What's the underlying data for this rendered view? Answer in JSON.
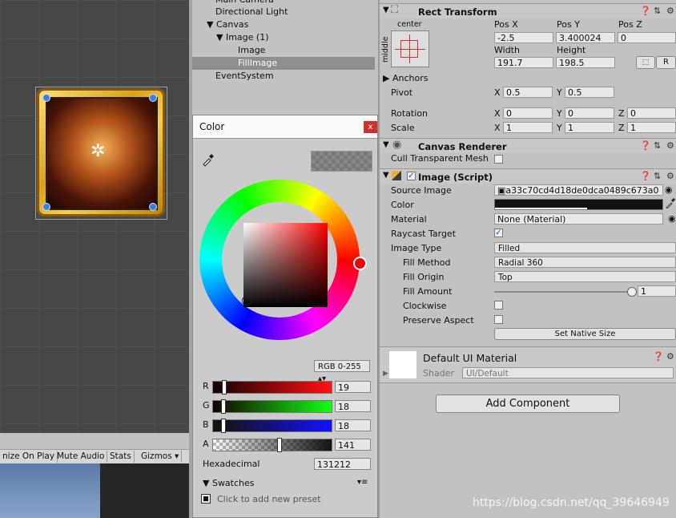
{
  "scene": {
    "pivot_glyph": "✲"
  },
  "game_toolbar": {
    "items": [
      "nize On Play",
      "Mute Audio",
      "Stats",
      "Gizmos ▾"
    ]
  },
  "hierarchy": {
    "items": [
      {
        "label": "Main Camera",
        "indent": 0
      },
      {
        "label": "Directional Light",
        "indent": 0
      },
      {
        "label": "▼ Canvas",
        "indent": 0
      },
      {
        "label": "▼ Image (1)",
        "indent": 1
      },
      {
        "label": "Image",
        "indent": 2
      },
      {
        "label": "FillImage",
        "indent": 2,
        "selected": true
      },
      {
        "label": "EventSystem",
        "indent": 0
      }
    ]
  },
  "color_picker": {
    "title": "Color",
    "close": "x",
    "mode": "RGB 0-255",
    "channels": [
      {
        "label": "R",
        "value": "19",
        "fill": 0.075
      },
      {
        "label": "G",
        "value": "18",
        "fill": 0.07
      },
      {
        "label": "B",
        "value": "18",
        "fill": 0.07
      },
      {
        "label": "A",
        "value": "141",
        "fill": 0.553
      }
    ],
    "hex_label": "Hexadecimal",
    "hex_value": "131212",
    "swatches_label": "▼ Swatches",
    "add_preset": "Click to add new preset"
  },
  "rect_transform": {
    "title": "Rect Transform",
    "anchor_h": "center",
    "anchor_v": "middle",
    "pos_x_label": "Pos X",
    "pos_y_label": "Pos Y",
    "pos_z_label": "Pos Z",
    "pos_x": "-2.5",
    "pos_y": "3.400024",
    "pos_z": "0",
    "width_label": "Width",
    "height_label": "Height",
    "width": "191.7",
    "height": "198.5",
    "r_button": "R",
    "anchors_label": "▶ Anchors",
    "pivot_label": "Pivot",
    "pivot_x": "0.5",
    "pivot_y": "0.5",
    "rotation_label": "Rotation",
    "rotation": [
      "0",
      "0",
      "0"
    ],
    "scale_label": "Scale",
    "scale": [
      "1",
      "1",
      "1"
    ],
    "x_label": "X",
    "y_label": "Y",
    "z_label": "Z"
  },
  "canvas_renderer": {
    "title": "Canvas Renderer",
    "cull_label": "Cull Transparent Mesh"
  },
  "image_script": {
    "title": "Image (Script)",
    "source_image_label": "Source Image",
    "source_image": "a33c70cd4d18de0dca0489c673a0",
    "color_label": "Color",
    "material_label": "Material",
    "material": "None (Material)",
    "raycast_label": "Raycast Target",
    "image_type_label": "Image Type",
    "image_type": "Filled",
    "fill_method_label": "Fill Method",
    "fill_method": "Radial 360",
    "fill_origin_label": "Fill Origin",
    "fill_origin": "Top",
    "fill_amount_label": "Fill Amount",
    "fill_amount": "1",
    "clockwise_label": "Clockwise",
    "preserve_label": "Preserve Aspect",
    "native_size": "Set Native Size"
  },
  "material_section": {
    "title": "Default UI Material",
    "shader_label": "Shader",
    "shader": "UI/Default"
  },
  "add_component": "Add Component",
  "watermark": "https://blog.csdn.net/qq_39646949"
}
